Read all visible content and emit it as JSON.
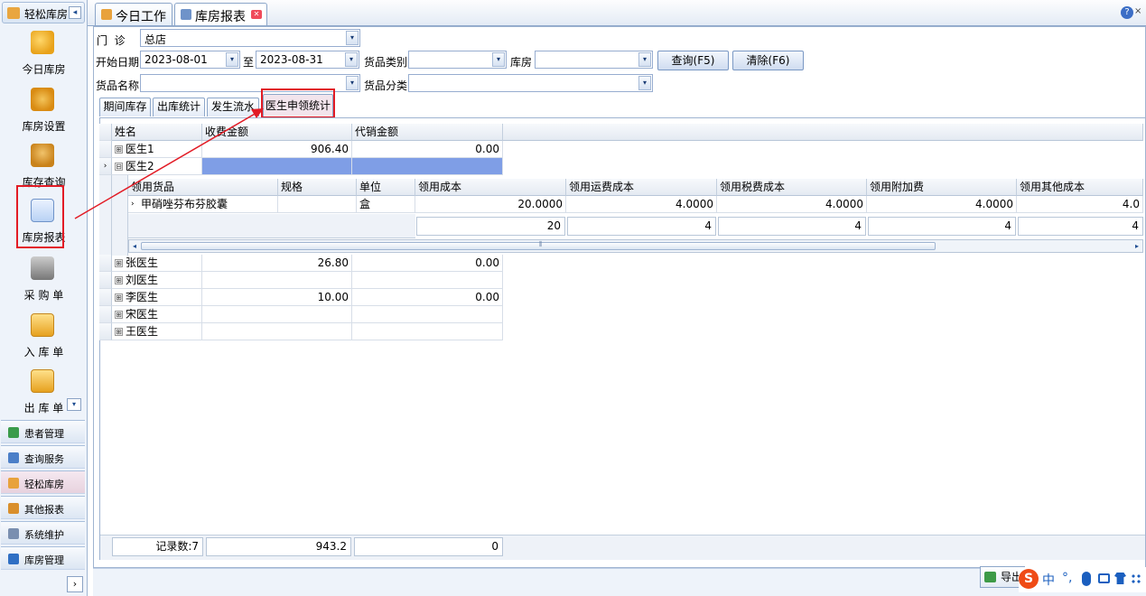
{
  "sidebar": {
    "header": "轻松库房",
    "nav": [
      {
        "id": "today",
        "label": "今日库房",
        "icon": "jar-icon"
      },
      {
        "id": "settings",
        "label": "库房设置",
        "icon": "gear-box-icon"
      },
      {
        "id": "inventory",
        "label": "库存查询",
        "icon": "boxes-icon"
      },
      {
        "id": "report",
        "label": "库房报表",
        "icon": "report-icon"
      },
      {
        "id": "purchase",
        "label": "采 购 单",
        "icon": "cart-icon"
      },
      {
        "id": "inbound",
        "label": "入 库 单",
        "icon": "inbox-icon"
      },
      {
        "id": "outbound",
        "label": "出 库 单",
        "icon": "outbox-icon"
      }
    ],
    "groups": [
      {
        "label": "患者管理",
        "color": "#3a9b4a"
      },
      {
        "label": "查询服务",
        "color": "#4b7fc8"
      },
      {
        "label": "轻松库房",
        "color": "#e8a23c",
        "active": true
      },
      {
        "label": "其他报表",
        "color": "#d98f2c"
      },
      {
        "label": "系统维护",
        "color": "#7a8fb0"
      },
      {
        "label": "库房管理",
        "color": "#2f6fc4"
      }
    ]
  },
  "tabs": [
    {
      "label": "今日工作",
      "icon": "home-icon"
    },
    {
      "label": "库房报表",
      "icon": "report-icon",
      "selected": true
    }
  ],
  "filters": {
    "clinic_label": "门  诊",
    "clinic_value": "总店",
    "start_label": "开始日期",
    "start_value": "2023-08-01",
    "to_label": "至",
    "end_value": "2023-08-31",
    "category_label": "货品类别",
    "category_value": "",
    "warehouse_label": "库房",
    "warehouse_value": "",
    "name_label": "货品名称",
    "name_value": "",
    "class_label": "货品分类",
    "class_value": "",
    "query_button": "查询(F5)",
    "clear_button": "清除(F6)"
  },
  "subtabs": [
    "期间库存",
    "出库统计",
    "发生流水",
    "医生申领统计"
  ],
  "grid": {
    "columns": [
      "姓名",
      "收费金额",
      "代销金额"
    ],
    "rows": [
      {
        "name": "医生1",
        "charge": "906.40",
        "consign": "0.00",
        "exp": "⊞"
      },
      {
        "name": "医生2",
        "charge": "",
        "consign": "",
        "exp": "⊟"
      },
      {
        "name": "张医生",
        "charge": "26.80",
        "consign": "0.00",
        "exp": "⊞"
      },
      {
        "name": "刘医生",
        "charge": "",
        "consign": "",
        "exp": "⊞"
      },
      {
        "name": "李医生",
        "charge": "10.00",
        "consign": "0.00",
        "exp": "⊞"
      },
      {
        "name": "宋医生",
        "charge": "",
        "consign": "",
        "exp": "⊞"
      },
      {
        "name": "王医生",
        "charge": "",
        "consign": "",
        "exp": "⊞"
      }
    ],
    "detail": {
      "columns": [
        "领用货品",
        "规格",
        "单位",
        "领用成本",
        "领用运费成本",
        "领用税费成本",
        "领用附加费",
        "领用其他成本"
      ],
      "row": [
        "甲硝唑芬布芬胶囊",
        "",
        "盒",
        "20.0000",
        "4.0000",
        "4.0000",
        "4.0000",
        "4.0"
      ],
      "summary": [
        "20",
        "4",
        "4",
        "4",
        "4"
      ]
    },
    "footer": {
      "count": "记录数:7",
      "charge_total": "943.2",
      "consign_total": "0"
    }
  },
  "bottom": {
    "export_label": "导出"
  },
  "ime": {
    "logo": "S",
    "mode": "中",
    "punct": "°,"
  },
  "help": {
    "help_glyph": "?",
    "close_glyph": "×"
  },
  "glyphs": {
    "collapse": "◂",
    "scroll_down": "▾",
    "expand_more": "›",
    "combo": "▾",
    "row_marker": "›",
    "arrow_left": "◂",
    "arrow_right": "▸",
    "tab_close": "✕",
    "hscroll_grip": "⦀"
  }
}
